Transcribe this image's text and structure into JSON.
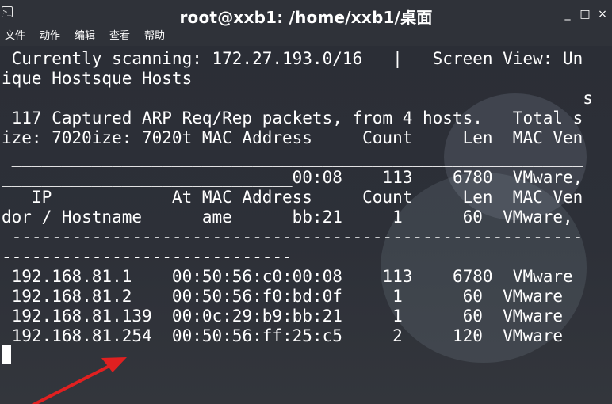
{
  "window": {
    "title": "root@xxb1: /home/xxb1/桌面",
    "buttons": [
      "_",
      "□",
      "×"
    ]
  },
  "menu": [
    "文件",
    "动作",
    "编辑",
    "查看",
    "帮助"
  ],
  "terminal": {
    "lines": [
      " Currently scanning: 172.27.193.0/16   |   Screen View: Un",
      "ique Hostsque Hosts",
      "                                                          s",
      " 117 Captured ARP Req/Rep packets, from 4 hosts.   Total s",
      "ize: 7020ize: 7020t MAC Address     Count     Len  MAC Ven",
      " _________________________________________________________",
      "_____________________________00:08    113    6780  VMware,",
      "   IP            At MAC Address     Count     Len  MAC Ven",
      "dor / Hostname      ame      bb:21     1      60  VMware,",
      " ---------------------------------------------------------",
      "-----------------------------",
      " 192.168.81.1    00:50:56:c0:00:08    113    6780  VMware",
      " 192.168.81.2    00:50:56:f0:bd:0f     1      60  VMware",
      " 192.168.81.139  00:0c:29:b9:bb:21     1      60  VMware",
      " 192.168.81.254  00:50:56:ff:25:c5     2     120  VMware"
    ]
  },
  "colors": {
    "annotation_arrow": "#e02020",
    "terminal_bg": "#2b2e36",
    "text": "#ffffff"
  }
}
